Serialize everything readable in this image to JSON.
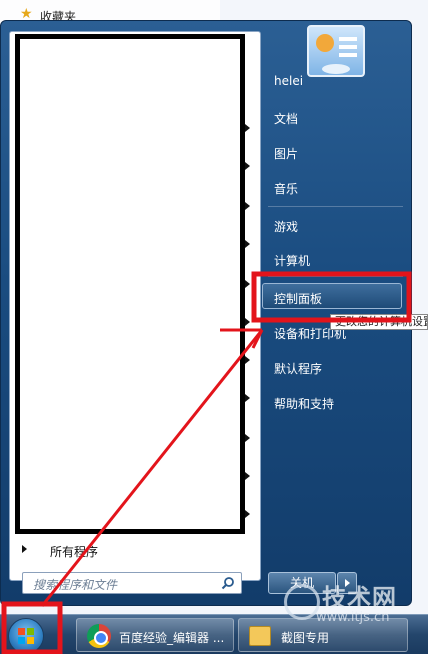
{
  "background": {
    "favorites_label": "收藏夹"
  },
  "start_menu": {
    "all_programs": "所有程序",
    "search_placeholder": "搜索程序和文件",
    "right_items": {
      "user": "helei",
      "documents": "文档",
      "pictures": "图片",
      "music": "音乐",
      "games": "游戏",
      "computer": "计算机",
      "control_panel": "控制面板",
      "devices_printers": "设备和打印机",
      "default_programs": "默认程序",
      "help_support": "帮助和支持"
    },
    "tooltip": "更改您的计算机设置",
    "shutdown_label": "关机"
  },
  "taskbar": {
    "chrome_task": "百度经验_编辑器 ...",
    "folder_task": "截图专用"
  },
  "watermark": {
    "brand": "技术网",
    "url": "www.itjs.cn"
  },
  "icons": {
    "favorites": "star-icon",
    "search": "search-icon",
    "start": "windows-start-orb-icon",
    "chrome": "chrome-icon",
    "folder": "folder-icon"
  },
  "colors": {
    "annotation_red": "#e3141b",
    "menu_blue": "#1a4c80"
  }
}
